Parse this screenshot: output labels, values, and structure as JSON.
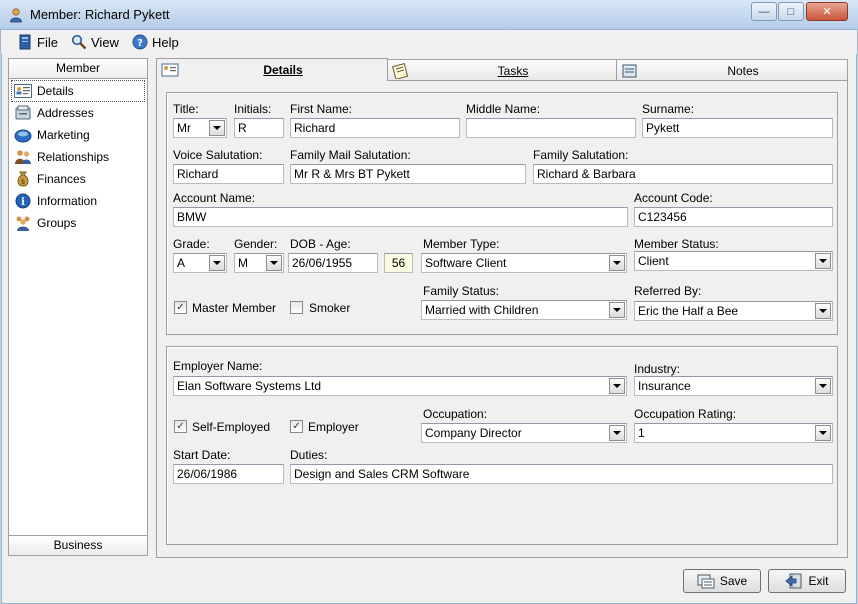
{
  "window": {
    "title": "Member: Richard Pykett",
    "close_glyph": "✕",
    "minimize_glyph": "—",
    "maximize_glyph": "□"
  },
  "menu": {
    "file": "File",
    "view": "View",
    "help": "Help"
  },
  "sidebar": {
    "header": "Member",
    "footer": "Business",
    "items": [
      {
        "label": "Details",
        "icon": "id-card-icon"
      },
      {
        "label": "Addresses",
        "icon": "address-book-icon"
      },
      {
        "label": "Marketing",
        "icon": "marketing-icon"
      },
      {
        "label": "Relationships",
        "icon": "people-icon"
      },
      {
        "label": "Finances",
        "icon": "money-bag-icon"
      },
      {
        "label": "Information",
        "icon": "info-icon"
      },
      {
        "label": "Groups",
        "icon": "group-icon"
      }
    ]
  },
  "tabs": {
    "details": "Details",
    "tasks": "Tasks",
    "notes": "Notes"
  },
  "form": {
    "title": {
      "label": "Title:",
      "value": "Mr"
    },
    "initials": {
      "label": "Initials:",
      "value": "R"
    },
    "first_name": {
      "label": "First Name:",
      "value": "Richard"
    },
    "middle_name": {
      "label": "Middle Name:",
      "value": ""
    },
    "surname": {
      "label": "Surname:",
      "value": "Pykett"
    },
    "voice_salutation": {
      "label": "Voice Salutation:",
      "value": "Richard"
    },
    "family_mail_salutation": {
      "label": "Family Mail Salutation:",
      "value": "Mr R & Mrs BT Pykett"
    },
    "family_salutation": {
      "label": "Family Salutation:",
      "value": "Richard & Barbara"
    },
    "account_name": {
      "label": "Account Name:",
      "value": "BMW"
    },
    "account_code": {
      "label": "Account Code:",
      "value": "C123456"
    },
    "grade": {
      "label": "Grade:",
      "value": "A"
    },
    "gender": {
      "label": "Gender:",
      "value": "M"
    },
    "dob": {
      "label": "DOB - Age:",
      "value": "26/06/1955",
      "age": "56"
    },
    "member_type": {
      "label": "Member Type:",
      "value": "Software Client"
    },
    "member_status": {
      "label": "Member Status:",
      "value": "Client"
    },
    "master_member": {
      "label": "Master Member",
      "checked": true
    },
    "smoker": {
      "label": "Smoker",
      "checked": false
    },
    "family_status": {
      "label": "Family Status:",
      "value": "Married with Children"
    },
    "referred_by": {
      "label": "Referred By:",
      "value": "Eric the Half a Bee"
    }
  },
  "employment": {
    "employer_name": {
      "label": "Employer Name:",
      "value": "Elan Software Systems Ltd"
    },
    "industry": {
      "label": "Industry:",
      "value": "Insurance"
    },
    "self_employed": {
      "label": "Self-Employed",
      "checked": true
    },
    "employer": {
      "label": "Employer",
      "checked": true
    },
    "occupation": {
      "label": "Occupation:",
      "value": "Company Director"
    },
    "occupation_rating": {
      "label": "Occupation Rating:",
      "value": "1"
    },
    "start_date": {
      "label": "Start Date:",
      "value": "26/06/1986"
    },
    "duties": {
      "label": "Duties:",
      "value": "Design and Sales CRM Software"
    }
  },
  "buttons": {
    "save": "Save",
    "exit": "Exit"
  },
  "check_glyph": "✓"
}
